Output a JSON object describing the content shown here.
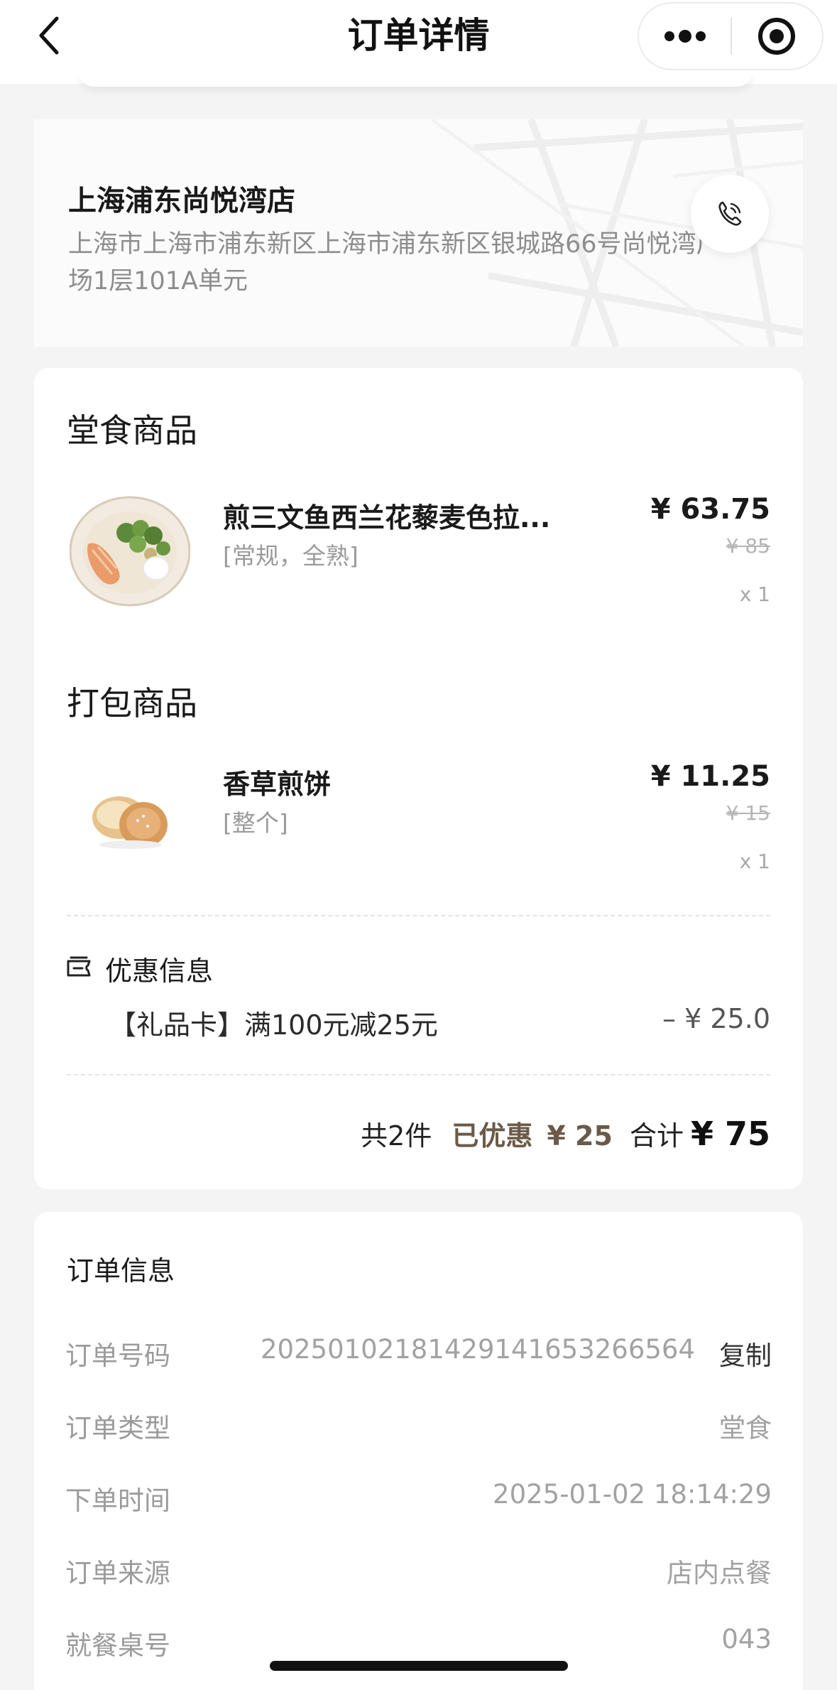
{
  "navbar": {
    "title": "订单详情",
    "back_icon": "chevron-left-icon",
    "more_icon": "more-dots-icon",
    "target_icon": "target-circle-icon"
  },
  "store": {
    "name": "上海浦东尚悦湾店",
    "address": "上海市上海市浦东新区上海市浦东新区银城路66号尚悦湾广场1层101A单元",
    "call_icon": "phone-icon"
  },
  "dine_in": {
    "section_title": "堂食商品",
    "items": [
      {
        "name": "煎三文鱼西兰花藜麦色拉...",
        "spec": "[常规，全熟]",
        "price": "¥ 63.75",
        "original_price": "¥ 85",
        "quantity": "x 1"
      }
    ]
  },
  "takeaway": {
    "section_title": "打包商品",
    "items": [
      {
        "name": "香草煎饼",
        "spec": "[整个]",
        "price": "¥ 11.25",
        "original_price": "¥ 15",
        "quantity": "x 1"
      }
    ]
  },
  "discount": {
    "title": "优惠信息",
    "icon": "ticket-icon",
    "text": "【礼品卡】满100元减25元",
    "amount": "– ¥ 25.0"
  },
  "summary": {
    "count": "共2件",
    "saved_label": "已优惠",
    "saved_value": "¥ 25",
    "total_label": "合计",
    "total_value": "¥ 75"
  },
  "order_info": {
    "title": "订单信息",
    "rows": [
      {
        "label": "订单号码",
        "value": "20250102181429141653266564",
        "action": "复制"
      },
      {
        "label": "订单类型",
        "value": "堂食"
      },
      {
        "label": "下单时间",
        "value": "2025-01-02 18:14:29"
      },
      {
        "label": "订单来源",
        "value": "店内点餐"
      },
      {
        "label": "就餐桌号",
        "value": "043"
      }
    ]
  },
  "colors": {
    "accent_brown": "#6b5a48",
    "background": "#f4f4f4"
  }
}
